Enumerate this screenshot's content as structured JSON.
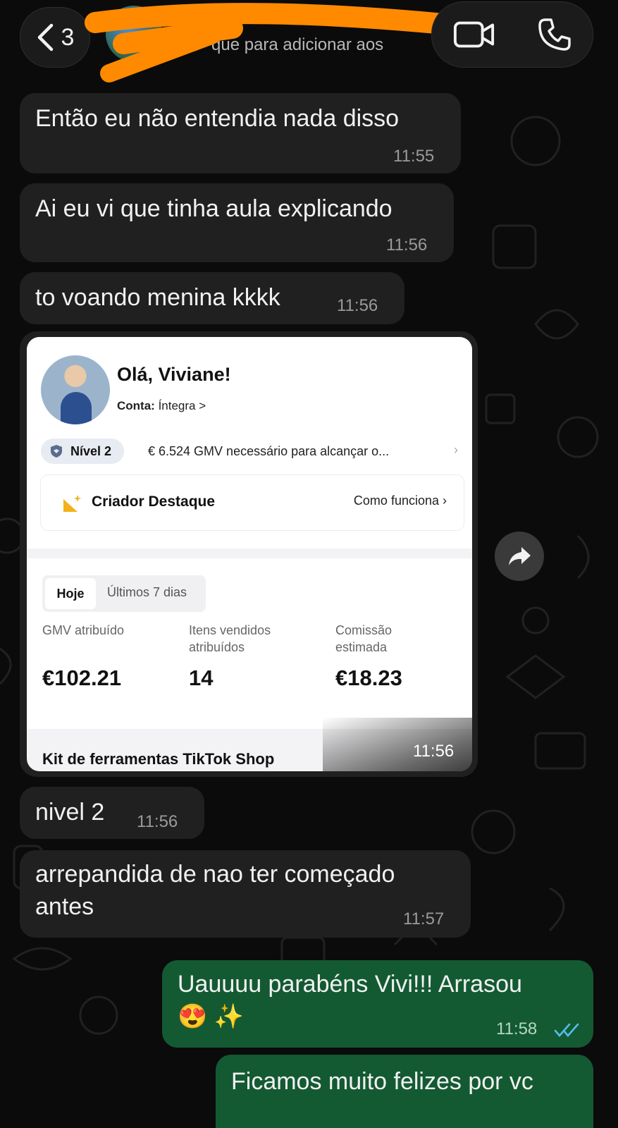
{
  "header": {
    "back_count": "3",
    "contact_subtitle": "que para adicionar aos",
    "video_call_label": "video-call",
    "voice_call_label": "voice-call"
  },
  "messages": [
    {
      "direction": "in",
      "text": "Então eu não entendia nada disso",
      "time": "11:55"
    },
    {
      "direction": "in",
      "text": "Ai eu vi que tinha aula explicando",
      "time": "11:56"
    },
    {
      "direction": "in",
      "text": "to voando menina kkkk",
      "time": "11:56"
    },
    {
      "direction": "in",
      "type": "image",
      "time": "11:56"
    },
    {
      "direction": "in",
      "text": "nivel 2",
      "time": "11:56"
    },
    {
      "direction": "in",
      "lines": [
        "arrepandida de nao ter começado",
        "antes"
      ],
      "time": "11:57"
    },
    {
      "direction": "out",
      "lines": [
        "Uauuuu parabéns Vivi!!! Arrasou",
        "😍 ✨"
      ],
      "time": "11:58",
      "status": "read"
    },
    {
      "direction": "out",
      "text": "Ficamos muito felizes por vc"
    }
  ],
  "shared_image": {
    "greeting": "Olá, Viviane!",
    "account_label": "Conta:",
    "account_value": "Íntegra >",
    "level": "Nível 2",
    "gmv_needed": "€ 6.524  GMV necessário para alcançar o...",
    "feature_name": "Criador Destaque",
    "feature_link": "Como funciona",
    "tabs": [
      "Hoje",
      "Últimos 7 dias"
    ],
    "metrics": [
      {
        "label_lines": [
          "GMV atribuído"
        ],
        "value": "€102.21"
      },
      {
        "label_lines": [
          "Itens vendidos",
          "atribuídos"
        ],
        "value": "14"
      },
      {
        "label_lines": [
          "Comissão",
          "estimada"
        ],
        "value": "€18.23"
      }
    ],
    "footer_cut": "Kit de ferramentas TikTok Shop"
  },
  "colors": {
    "background": "#0b0b0b",
    "incoming_bubble": "#202020",
    "outgoing_bubble": "#135a33",
    "redaction": "#ff8a00",
    "read_ticks": "#53bdeb"
  }
}
